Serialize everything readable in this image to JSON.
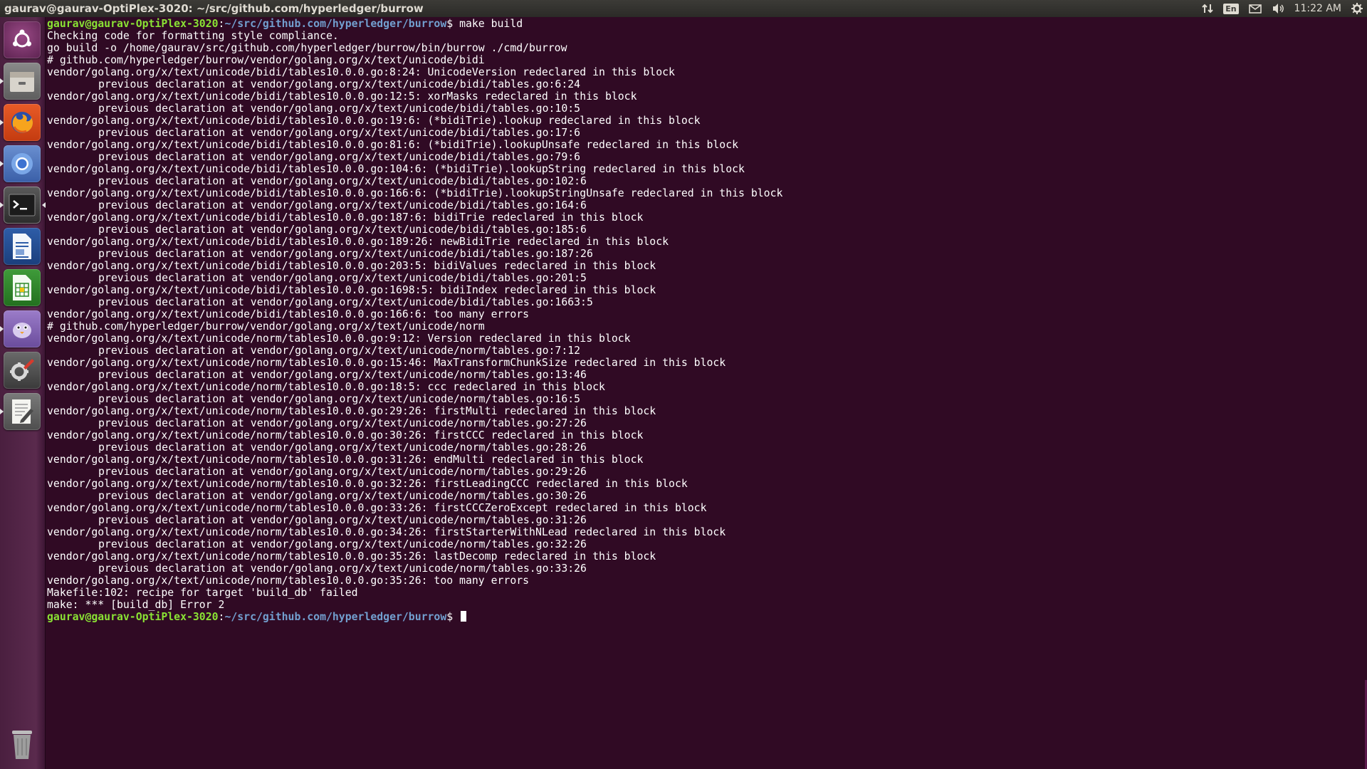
{
  "window": {
    "title": "gaurav@gaurav-OptiPlex-3020: ~/src/github.com/hyperledger/burrow"
  },
  "tray": {
    "keyboard_layout": "En",
    "clock": "11:22 AM",
    "icons": [
      "network-icon",
      "keyboard-icon",
      "mail-icon",
      "volume-icon",
      "gear-icon"
    ]
  },
  "launcher": {
    "items": [
      "dash-home-icon",
      "files-icon",
      "firefox-icon",
      "chromium-icon",
      "terminal-icon",
      "writer-icon",
      "calc-icon",
      "pidgin-icon",
      "system-settings-icon",
      "text-editor-icon",
      "trash-icon"
    ]
  },
  "terminal": {
    "colors": {
      "background": "#300a24",
      "user": "#8ae234",
      "path": "#729fcf",
      "text": "#ffffff"
    },
    "prompt_user": "gaurav@gaurav-OptiPlex-3020",
    "prompt_path": "~/src/github.com/hyperledger/burrow",
    "command": "make build",
    "lines": [
      {
        "t": "Checking code for formatting style compliance."
      },
      {
        "t": "go build -o /home/gaurav/src/github.com/hyperledger/burrow/bin/burrow ./cmd/burrow"
      },
      {
        "t": "# github.com/hyperledger/burrow/vendor/golang.org/x/text/unicode/bidi"
      },
      {
        "t": "vendor/golang.org/x/text/unicode/bidi/tables10.0.0.go:8:24: UnicodeVersion redeclared in this block"
      },
      {
        "t": "previous declaration at vendor/golang.org/x/text/unicode/bidi/tables.go:6:24",
        "ind": true
      },
      {
        "t": "vendor/golang.org/x/text/unicode/bidi/tables10.0.0.go:12:5: xorMasks redeclared in this block"
      },
      {
        "t": "previous declaration at vendor/golang.org/x/text/unicode/bidi/tables.go:10:5",
        "ind": true
      },
      {
        "t": "vendor/golang.org/x/text/unicode/bidi/tables10.0.0.go:19:6: (*bidiTrie).lookup redeclared in this block"
      },
      {
        "t": "previous declaration at vendor/golang.org/x/text/unicode/bidi/tables.go:17:6",
        "ind": true
      },
      {
        "t": "vendor/golang.org/x/text/unicode/bidi/tables10.0.0.go:81:6: (*bidiTrie).lookupUnsafe redeclared in this block"
      },
      {
        "t": "previous declaration at vendor/golang.org/x/text/unicode/bidi/tables.go:79:6",
        "ind": true
      },
      {
        "t": "vendor/golang.org/x/text/unicode/bidi/tables10.0.0.go:104:6: (*bidiTrie).lookupString redeclared in this block"
      },
      {
        "t": "previous declaration at vendor/golang.org/x/text/unicode/bidi/tables.go:102:6",
        "ind": true
      },
      {
        "t": "vendor/golang.org/x/text/unicode/bidi/tables10.0.0.go:166:6: (*bidiTrie).lookupStringUnsafe redeclared in this block"
      },
      {
        "t": "previous declaration at vendor/golang.org/x/text/unicode/bidi/tables.go:164:6",
        "ind": true
      },
      {
        "t": "vendor/golang.org/x/text/unicode/bidi/tables10.0.0.go:187:6: bidiTrie redeclared in this block"
      },
      {
        "t": "previous declaration at vendor/golang.org/x/text/unicode/bidi/tables.go:185:6",
        "ind": true
      },
      {
        "t": "vendor/golang.org/x/text/unicode/bidi/tables10.0.0.go:189:26: newBidiTrie redeclared in this block"
      },
      {
        "t": "previous declaration at vendor/golang.org/x/text/unicode/bidi/tables.go:187:26",
        "ind": true
      },
      {
        "t": "vendor/golang.org/x/text/unicode/bidi/tables10.0.0.go:203:5: bidiValues redeclared in this block"
      },
      {
        "t": "previous declaration at vendor/golang.org/x/text/unicode/bidi/tables.go:201:5",
        "ind": true
      },
      {
        "t": "vendor/golang.org/x/text/unicode/bidi/tables10.0.0.go:1698:5: bidiIndex redeclared in this block"
      },
      {
        "t": "previous declaration at vendor/golang.org/x/text/unicode/bidi/tables.go:1663:5",
        "ind": true
      },
      {
        "t": "vendor/golang.org/x/text/unicode/bidi/tables10.0.0.go:166:6: too many errors"
      },
      {
        "t": "# github.com/hyperledger/burrow/vendor/golang.org/x/text/unicode/norm"
      },
      {
        "t": "vendor/golang.org/x/text/unicode/norm/tables10.0.0.go:9:12: Version redeclared in this block"
      },
      {
        "t": "previous declaration at vendor/golang.org/x/text/unicode/norm/tables.go:7:12",
        "ind": true
      },
      {
        "t": "vendor/golang.org/x/text/unicode/norm/tables10.0.0.go:15:46: MaxTransformChunkSize redeclared in this block"
      },
      {
        "t": "previous declaration at vendor/golang.org/x/text/unicode/norm/tables.go:13:46",
        "ind": true
      },
      {
        "t": "vendor/golang.org/x/text/unicode/norm/tables10.0.0.go:18:5: ccc redeclared in this block"
      },
      {
        "t": "previous declaration at vendor/golang.org/x/text/unicode/norm/tables.go:16:5",
        "ind": true
      },
      {
        "t": "vendor/golang.org/x/text/unicode/norm/tables10.0.0.go:29:26: firstMulti redeclared in this block"
      },
      {
        "t": "previous declaration at vendor/golang.org/x/text/unicode/norm/tables.go:27:26",
        "ind": true
      },
      {
        "t": "vendor/golang.org/x/text/unicode/norm/tables10.0.0.go:30:26: firstCCC redeclared in this block"
      },
      {
        "t": "previous declaration at vendor/golang.org/x/text/unicode/norm/tables.go:28:26",
        "ind": true
      },
      {
        "t": "vendor/golang.org/x/text/unicode/norm/tables10.0.0.go:31:26: endMulti redeclared in this block"
      },
      {
        "t": "previous declaration at vendor/golang.org/x/text/unicode/norm/tables.go:29:26",
        "ind": true
      },
      {
        "t": "vendor/golang.org/x/text/unicode/norm/tables10.0.0.go:32:26: firstLeadingCCC redeclared in this block"
      },
      {
        "t": "previous declaration at vendor/golang.org/x/text/unicode/norm/tables.go:30:26",
        "ind": true
      },
      {
        "t": "vendor/golang.org/x/text/unicode/norm/tables10.0.0.go:33:26: firstCCCZeroExcept redeclared in this block"
      },
      {
        "t": "previous declaration at vendor/golang.org/x/text/unicode/norm/tables.go:31:26",
        "ind": true
      },
      {
        "t": "vendor/golang.org/x/text/unicode/norm/tables10.0.0.go:34:26: firstStarterWithNLead redeclared in this block"
      },
      {
        "t": "previous declaration at vendor/golang.org/x/text/unicode/norm/tables.go:32:26",
        "ind": true
      },
      {
        "t": "vendor/golang.org/x/text/unicode/norm/tables10.0.0.go:35:26: lastDecomp redeclared in this block"
      },
      {
        "t": "previous declaration at vendor/golang.org/x/text/unicode/norm/tables.go:33:26",
        "ind": true
      },
      {
        "t": "vendor/golang.org/x/text/unicode/norm/tables10.0.0.go:35:26: too many errors"
      },
      {
        "t": "Makefile:102: recipe for target 'build_db' failed"
      },
      {
        "t": "make: *** [build_db] Error 2"
      }
    ]
  }
}
